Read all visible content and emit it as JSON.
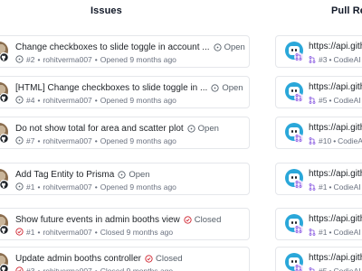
{
  "columns": {
    "issues_title": "Issues",
    "prs_title": "Pull Requests"
  },
  "issues": [
    {
      "title": "Change checkboxes to slide toggle in account ...",
      "status": "Open",
      "number": "#2",
      "author": "rohitverma007",
      "verb": "Opened",
      "time": "9 months ago"
    },
    {
      "title": "[HTML] Change checkboxes to slide toggle in ...",
      "status": "Open",
      "number": "#4",
      "author": "rohitverma007",
      "verb": "Opened",
      "time": "9 months ago"
    },
    {
      "title": "Do not show total for area and scatter plot",
      "status": "Open",
      "number": "#7",
      "author": "rohitverma007",
      "verb": "Opened",
      "time": "9 months ago"
    },
    {
      "title": "Add Tag Entity to Prisma",
      "status": "Open",
      "number": "#1",
      "author": "rohitverma007",
      "verb": "Opened",
      "time": "9 months ago"
    },
    {
      "title": "Show future events in admin booths view",
      "status": "Closed",
      "number": "#1",
      "author": "rohitverma007",
      "verb": "Closed",
      "time": "9 months ago"
    },
    {
      "title": "Update admin booths controller",
      "status": "Closed",
      "number": "#3",
      "author": "rohitverma007",
      "verb": "Closed",
      "time": "9 months ago"
    }
  ],
  "pull_requests": [
    {
      "title": "https://api.github",
      "number": "#3",
      "author": "CodieAI"
    },
    {
      "title": "https://api.github",
      "number": "#5",
      "author": "CodieAI"
    },
    {
      "title": "https://api.github",
      "number": "#10",
      "author": "CodieAI"
    },
    {
      "title": "https://api.github",
      "number": "#1",
      "author": "CodieAI"
    },
    {
      "title": "https://api.github",
      "number": "#1",
      "author": "CodieAI"
    },
    {
      "title": "https://api.github",
      "number": "#5",
      "author": "CodieAI"
    }
  ],
  "icons": {
    "open": "issue-open-icon",
    "closed": "issue-closed-icon",
    "github": "github-icon",
    "merge": "pull-request-icon"
  },
  "colors": {
    "open_icon": "#57606a",
    "closed_icon": "#cf222e",
    "pr_icon": "#8250df",
    "border": "#e5e7eb",
    "muted_text": "#6b7280"
  }
}
